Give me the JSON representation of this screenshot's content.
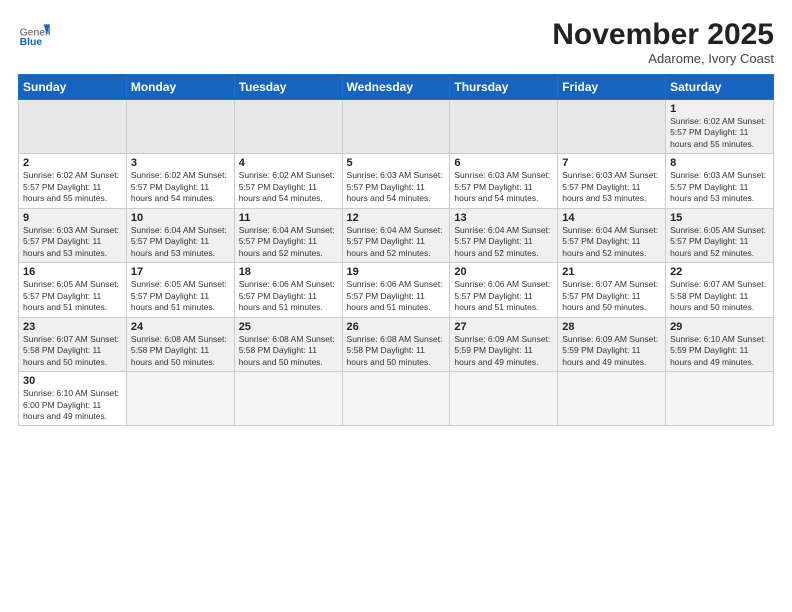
{
  "header": {
    "logo_general": "General",
    "logo_blue": "Blue",
    "month_title": "November 2025",
    "location": "Adarome, Ivory Coast"
  },
  "weekdays": [
    "Sunday",
    "Monday",
    "Tuesday",
    "Wednesday",
    "Thursday",
    "Friday",
    "Saturday"
  ],
  "weeks": [
    [
      {
        "day": "",
        "info": ""
      },
      {
        "day": "",
        "info": ""
      },
      {
        "day": "",
        "info": ""
      },
      {
        "day": "",
        "info": ""
      },
      {
        "day": "",
        "info": ""
      },
      {
        "day": "",
        "info": ""
      },
      {
        "day": "1",
        "info": "Sunrise: 6:02 AM\nSunset: 5:57 PM\nDaylight: 11 hours\nand 55 minutes."
      }
    ],
    [
      {
        "day": "2",
        "info": "Sunrise: 6:02 AM\nSunset: 5:57 PM\nDaylight: 11 hours\nand 55 minutes."
      },
      {
        "day": "3",
        "info": "Sunrise: 6:02 AM\nSunset: 5:57 PM\nDaylight: 11 hours\nand 54 minutes."
      },
      {
        "day": "4",
        "info": "Sunrise: 6:02 AM\nSunset: 5:57 PM\nDaylight: 11 hours\nand 54 minutes."
      },
      {
        "day": "5",
        "info": "Sunrise: 6:03 AM\nSunset: 5:57 PM\nDaylight: 11 hours\nand 54 minutes."
      },
      {
        "day": "6",
        "info": "Sunrise: 6:03 AM\nSunset: 5:57 PM\nDaylight: 11 hours\nand 54 minutes."
      },
      {
        "day": "7",
        "info": "Sunrise: 6:03 AM\nSunset: 5:57 PM\nDaylight: 11 hours\nand 53 minutes."
      },
      {
        "day": "8",
        "info": "Sunrise: 6:03 AM\nSunset: 5:57 PM\nDaylight: 11 hours\nand 53 minutes."
      }
    ],
    [
      {
        "day": "9",
        "info": "Sunrise: 6:03 AM\nSunset: 5:57 PM\nDaylight: 11 hours\nand 53 minutes."
      },
      {
        "day": "10",
        "info": "Sunrise: 6:04 AM\nSunset: 5:57 PM\nDaylight: 11 hours\nand 53 minutes."
      },
      {
        "day": "11",
        "info": "Sunrise: 6:04 AM\nSunset: 5:57 PM\nDaylight: 11 hours\nand 52 minutes."
      },
      {
        "day": "12",
        "info": "Sunrise: 6:04 AM\nSunset: 5:57 PM\nDaylight: 11 hours\nand 52 minutes."
      },
      {
        "day": "13",
        "info": "Sunrise: 6:04 AM\nSunset: 5:57 PM\nDaylight: 11 hours\nand 52 minutes."
      },
      {
        "day": "14",
        "info": "Sunrise: 6:04 AM\nSunset: 5:57 PM\nDaylight: 11 hours\nand 52 minutes."
      },
      {
        "day": "15",
        "info": "Sunrise: 6:05 AM\nSunset: 5:57 PM\nDaylight: 11 hours\nand 52 minutes."
      }
    ],
    [
      {
        "day": "16",
        "info": "Sunrise: 6:05 AM\nSunset: 5:57 PM\nDaylight: 11 hours\nand 51 minutes."
      },
      {
        "day": "17",
        "info": "Sunrise: 6:05 AM\nSunset: 5:57 PM\nDaylight: 11 hours\nand 51 minutes."
      },
      {
        "day": "18",
        "info": "Sunrise: 6:06 AM\nSunset: 5:57 PM\nDaylight: 11 hours\nand 51 minutes."
      },
      {
        "day": "19",
        "info": "Sunrise: 6:06 AM\nSunset: 5:57 PM\nDaylight: 11 hours\nand 51 minutes."
      },
      {
        "day": "20",
        "info": "Sunrise: 6:06 AM\nSunset: 5:57 PM\nDaylight: 11 hours\nand 51 minutes."
      },
      {
        "day": "21",
        "info": "Sunrise: 6:07 AM\nSunset: 5:57 PM\nDaylight: 11 hours\nand 50 minutes."
      },
      {
        "day": "22",
        "info": "Sunrise: 6:07 AM\nSunset: 5:58 PM\nDaylight: 11 hours\nand 50 minutes."
      }
    ],
    [
      {
        "day": "23",
        "info": "Sunrise: 6:07 AM\nSunset: 5:58 PM\nDaylight: 11 hours\nand 50 minutes."
      },
      {
        "day": "24",
        "info": "Sunrise: 6:08 AM\nSunset: 5:58 PM\nDaylight: 11 hours\nand 50 minutes."
      },
      {
        "day": "25",
        "info": "Sunrise: 6:08 AM\nSunset: 5:58 PM\nDaylight: 11 hours\nand 50 minutes."
      },
      {
        "day": "26",
        "info": "Sunrise: 6:08 AM\nSunset: 5:58 PM\nDaylight: 11 hours\nand 50 minutes."
      },
      {
        "day": "27",
        "info": "Sunrise: 6:09 AM\nSunset: 5:59 PM\nDaylight: 11 hours\nand 49 minutes."
      },
      {
        "day": "28",
        "info": "Sunrise: 6:09 AM\nSunset: 5:59 PM\nDaylight: 11 hours\nand 49 minutes."
      },
      {
        "day": "29",
        "info": "Sunrise: 6:10 AM\nSunset: 5:59 PM\nDaylight: 11 hours\nand 49 minutes."
      }
    ],
    [
      {
        "day": "30",
        "info": "Sunrise: 6:10 AM\nSunset: 6:00 PM\nDaylight: 11 hours\nand 49 minutes."
      },
      {
        "day": "",
        "info": ""
      },
      {
        "day": "",
        "info": ""
      },
      {
        "day": "",
        "info": ""
      },
      {
        "day": "",
        "info": ""
      },
      {
        "day": "",
        "info": ""
      },
      {
        "day": "",
        "info": ""
      }
    ]
  ]
}
